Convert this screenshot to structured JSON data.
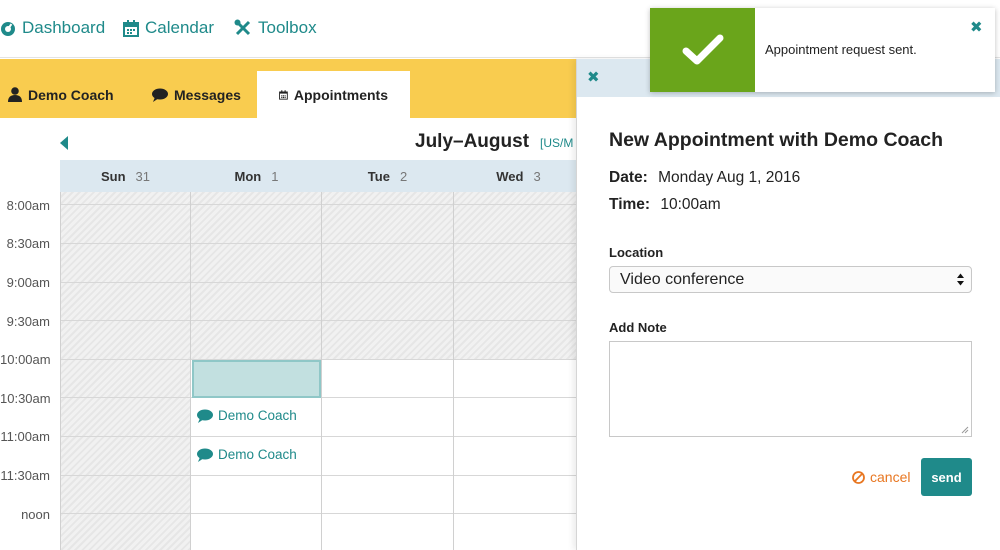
{
  "nav": {
    "items": [
      {
        "label": "Dashboard",
        "icon": "dashboard-icon"
      },
      {
        "label": "Calendar",
        "icon": "calendar-icon"
      },
      {
        "label": "Toolbox",
        "icon": "tools-icon"
      }
    ]
  },
  "tabs": [
    {
      "label": "Demo Coach",
      "icon": "user-icon"
    },
    {
      "label": "Messages",
      "icon": "chat-bubble-icon"
    },
    {
      "label": "Appointments",
      "icon": "calendar-icon"
    }
  ],
  "calendar": {
    "title": "July–August",
    "timezone": "[US/M",
    "days": [
      {
        "name": "Sun",
        "num": "31"
      },
      {
        "name": "Mon",
        "num": "1"
      },
      {
        "name": "Tue",
        "num": "2"
      },
      {
        "name": "Wed",
        "num": "3"
      }
    ],
    "times": [
      "8:00am",
      "8:30am",
      "9:00am",
      "9:30am",
      "10:00am",
      "10:30am",
      "11:00am",
      "11:30am",
      "noon"
    ],
    "events": [
      {
        "label": "Demo Coach"
      },
      {
        "label": "Demo Coach"
      }
    ]
  },
  "panel": {
    "title": "New Appointment with Demo Coach",
    "date_label": "Date:",
    "date_value": "Monday Aug 1, 2016",
    "time_label": "Time:",
    "time_value": "10:00am",
    "location_label": "Location",
    "location_value": "Video conference",
    "note_label": "Add Note",
    "note_value": "",
    "cancel_label": "cancel",
    "send_label": "send"
  },
  "toast": {
    "message": "Appointment request sent."
  },
  "colors": {
    "accent": "#1f8a8a",
    "tab_bar": "#f9cc4f",
    "success": "#6aa51b",
    "cancel": "#e87722",
    "header_bg": "#dce8f0"
  }
}
